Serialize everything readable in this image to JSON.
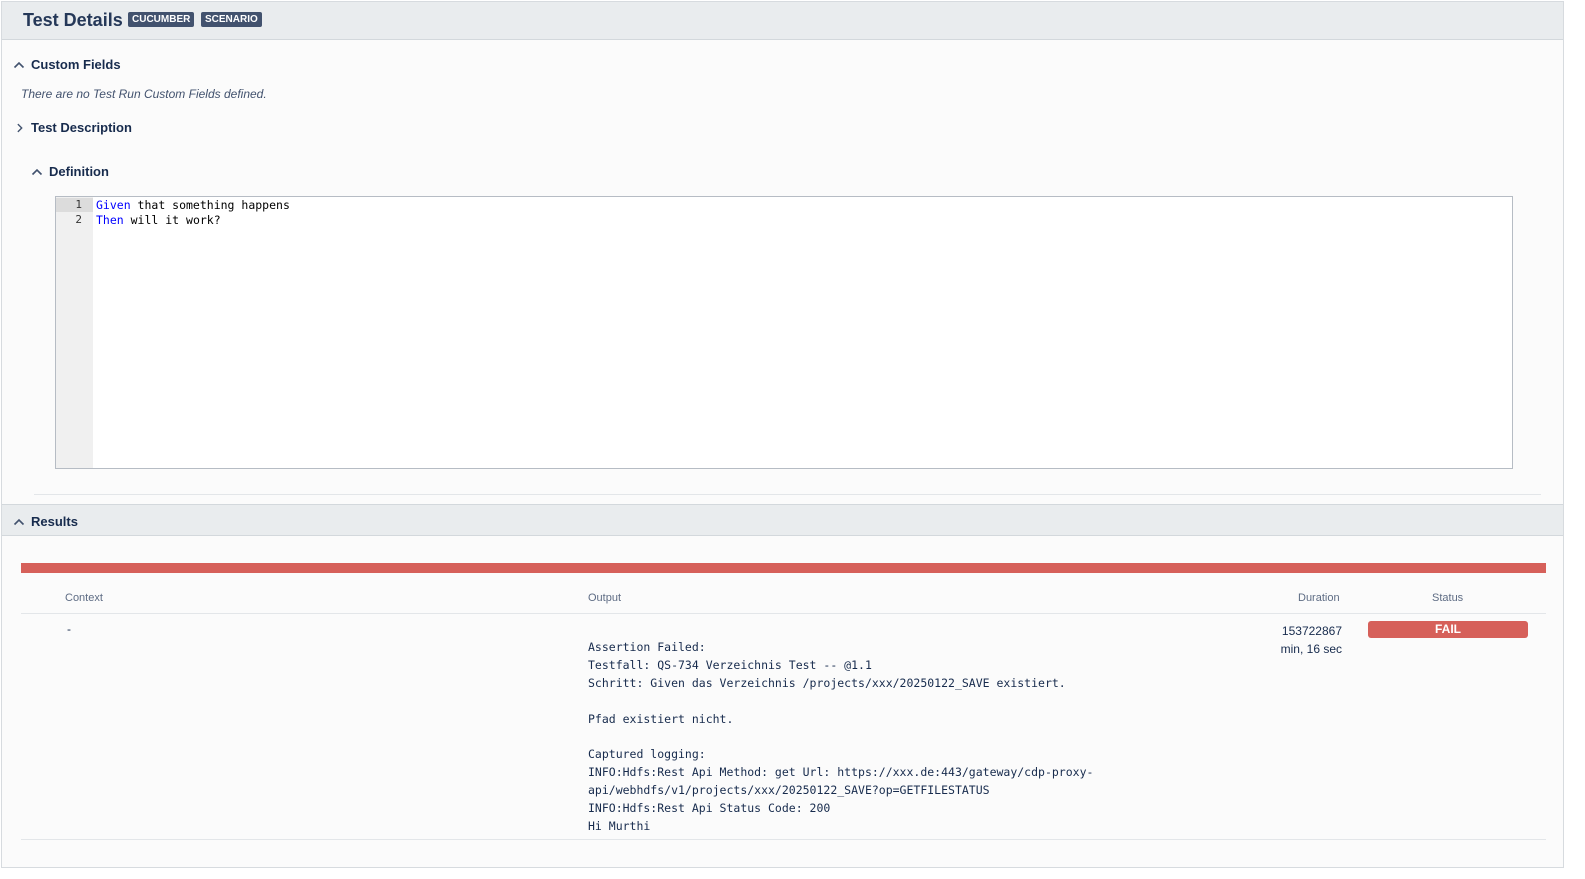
{
  "header": {
    "title": "Test Details",
    "badges": [
      "CUCUMBER",
      "SCENARIO"
    ]
  },
  "sections": {
    "custom_fields": {
      "label": "Custom Fields",
      "expanded": true,
      "empty_message": "There are no Test Run Custom Fields defined."
    },
    "test_description": {
      "label": "Test Description",
      "expanded": false
    },
    "definition": {
      "label": "Definition",
      "expanded": true,
      "lines": [
        {
          "num": "1",
          "keyword": "Given",
          "rest": " that something happens"
        },
        {
          "num": "2",
          "keyword": "Then",
          "rest": " will it work?"
        }
      ]
    },
    "results": {
      "label": "Results",
      "expanded": true
    }
  },
  "results_table": {
    "headers": {
      "context": "Context",
      "output": "Output",
      "duration": "Duration",
      "status": "Status"
    },
    "rows": [
      {
        "context": "-",
        "output": "Assertion Failed:\nTestfall: QS-734 Verzeichnis Test -- @1.1\nSchritt: Given das Verzeichnis /projects/xxx/20250122_SAVE existiert.\n\nPfad existiert nicht.\n\nCaptured logging:\nINFO:Hdfs:Rest Api Method: get Url: https://xxx.de:443/gateway/cdp-proxy-\napi/webhdfs/v1/projects/xxx/20250122_SAVE?op=GETFILESTATUS\nINFO:Hdfs:Rest Api Status Code: 200\nHi Murthi",
        "duration_line1": "153722867",
        "duration_line2": "min, 16 sec",
        "status": "FAIL"
      }
    ]
  },
  "colors": {
    "fail": "#d6605a",
    "badge": "#42526e",
    "header_bg": "#e9ecee",
    "keyword": "#0000ff"
  },
  "icons": {
    "expanded": "chevron-up-icon",
    "collapsed": "chevron-right-icon"
  }
}
